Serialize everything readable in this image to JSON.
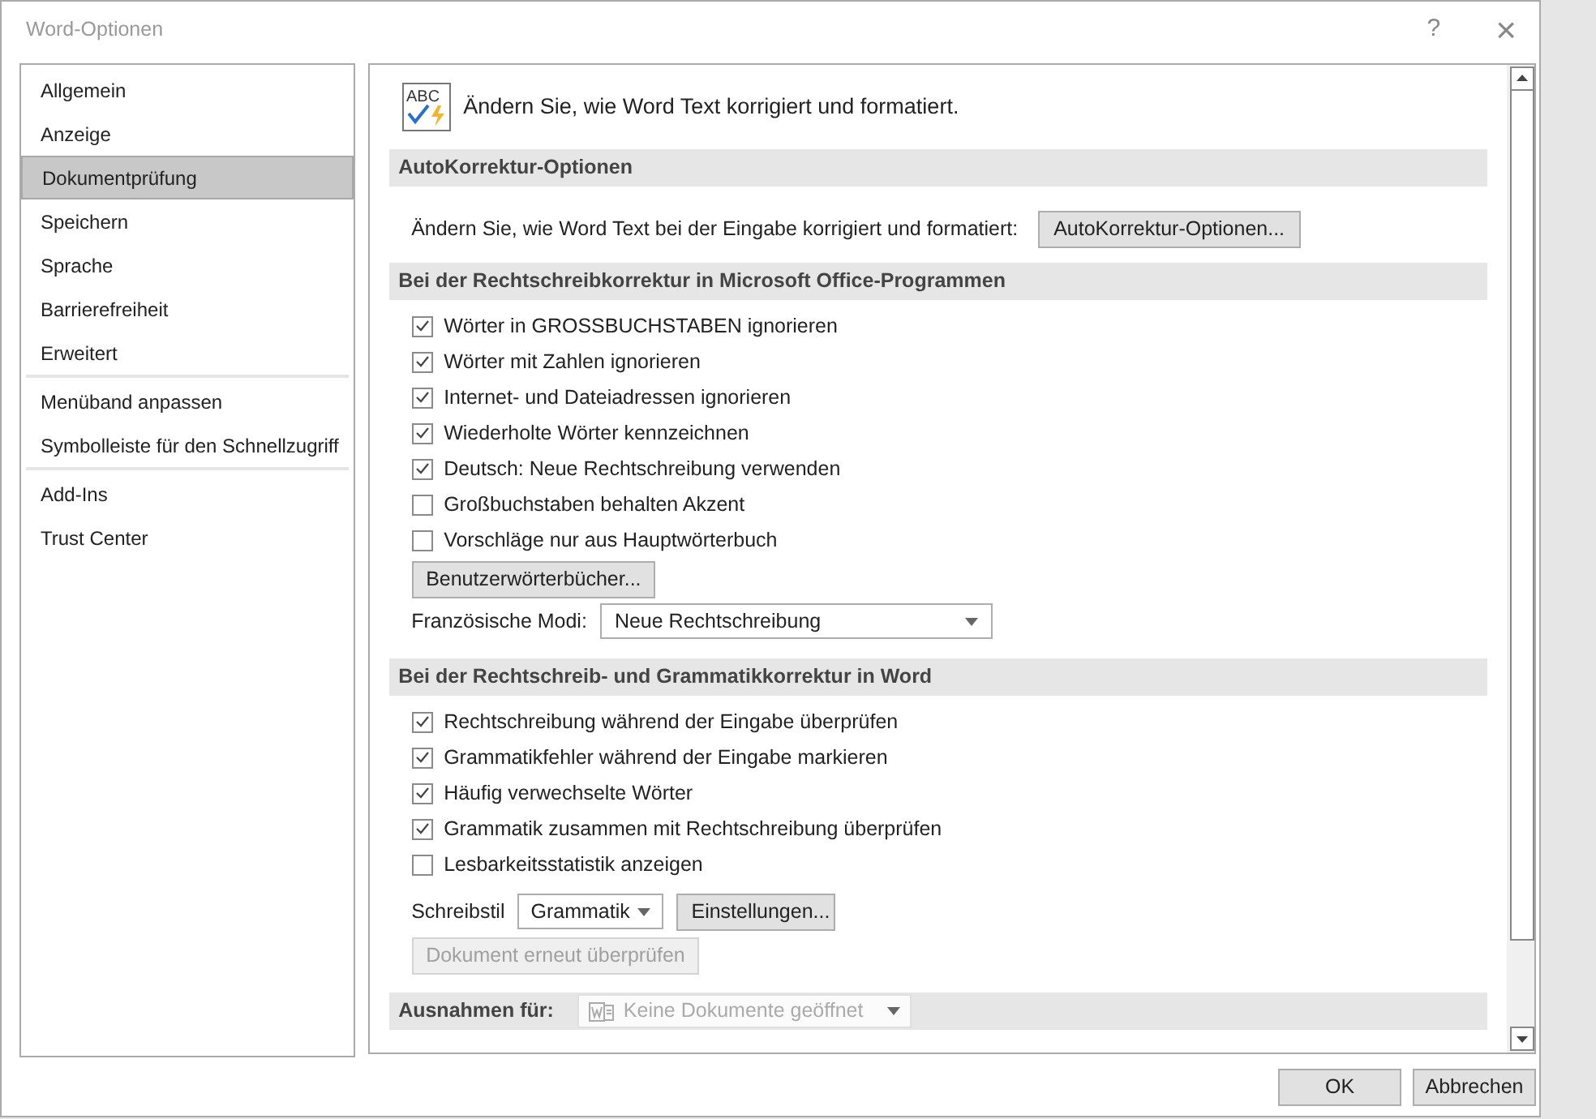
{
  "window": {
    "title": "Word-Optionen",
    "help": "?",
    "close": "×"
  },
  "sidebar": {
    "groups": [
      [
        {
          "label": "Allgemein",
          "selected": false
        },
        {
          "label": "Anzeige",
          "selected": false
        },
        {
          "label": "Dokumentprüfung",
          "selected": true
        },
        {
          "label": "Speichern",
          "selected": false
        },
        {
          "label": "Sprache",
          "selected": false
        },
        {
          "label": "Barrierefreiheit",
          "selected": false
        },
        {
          "label": "Erweitert",
          "selected": false
        }
      ],
      [
        {
          "label": "Menüband anpassen",
          "selected": false
        },
        {
          "label": "Symbolleiste für den Schnellzugriff",
          "selected": false
        }
      ],
      [
        {
          "label": "Add-Ins",
          "selected": false
        },
        {
          "label": "Trust Center",
          "selected": false
        }
      ]
    ]
  },
  "intro_icon_text": "ABC",
  "intro": "Ändern Sie, wie Word Text korrigiert und formatiert.",
  "sections": [
    {
      "heading": "AutoKorrektur-Optionen",
      "rows": [
        {
          "kind": "label_button",
          "label": "Ändern Sie, wie Word Text bei der Eingabe korrigiert und formatiert:",
          "button": "AutoKorrektur-Optionen..."
        }
      ]
    },
    {
      "heading": "Bei der Rechtschreibkorrektur in Microsoft Office-Programmen",
      "rows": [
        {
          "kind": "checkbox",
          "label": "Wörter in GROSSBUCHSTABEN ignorieren",
          "checked": true
        },
        {
          "kind": "checkbox",
          "label": "Wörter mit Zahlen ignorieren",
          "checked": true
        },
        {
          "kind": "checkbox",
          "label": "Internet- und Dateiadressen ignorieren",
          "checked": true
        },
        {
          "kind": "checkbox",
          "label": "Wiederholte Wörter kennzeichnen",
          "checked": true
        },
        {
          "kind": "checkbox",
          "label": "Deutsch: Neue Rechtschreibung verwenden",
          "checked": true
        },
        {
          "kind": "checkbox",
          "label": "Großbuchstaben behalten Akzent",
          "checked": false
        },
        {
          "kind": "checkbox",
          "label": "Vorschläge nur aus Hauptwörterbuch",
          "checked": false
        },
        {
          "kind": "button",
          "label": "Benutzerwörterbücher...",
          "disabled": false
        },
        {
          "kind": "select",
          "label": "Französische Modi:",
          "value": "Neue Rechtschreibung"
        }
      ]
    },
    {
      "heading": "Bei der Rechtschreib- und Grammatikkorrektur in Word",
      "rows": [
        {
          "kind": "checkbox",
          "label": "Rechtschreibung während der Eingabe überprüfen",
          "checked": true
        },
        {
          "kind": "checkbox",
          "label": "Grammatikfehler während der Eingabe markieren",
          "checked": true
        },
        {
          "kind": "checkbox",
          "label": "Häufig verwechselte Wörter",
          "checked": true
        },
        {
          "kind": "checkbox",
          "label": "Grammatik zusammen mit Rechtschreibung überprüfen",
          "checked": true
        },
        {
          "kind": "checkbox",
          "label": "Lesbarkeitsstatistik anzeigen",
          "checked": false
        },
        {
          "kind": "select_button",
          "label": "Schreibstil",
          "value": "Grammatik",
          "button": "Einstellungen..."
        },
        {
          "kind": "button",
          "label": "Dokument erneut überprüfen",
          "disabled": true
        }
      ]
    },
    {
      "heading": "Ausnahmen für:",
      "select": {
        "value": "Keine Dokumente geöffnet",
        "disabled": true
      }
    }
  ],
  "footer": {
    "buttons": [
      "OK",
      "Abbrechen"
    ]
  }
}
